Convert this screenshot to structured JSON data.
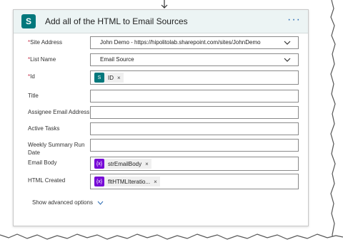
{
  "action": {
    "title": "Add all of the HTML to Email Sources",
    "more_label": "···",
    "logo_letter": "S"
  },
  "fields": [
    {
      "label": "Site Address",
      "required": true,
      "value": "John Demo - https://hipolitolab.sharepoint.com/sites/JohnDemo",
      "type": "dropdown"
    },
    {
      "label": "List Name",
      "required": true,
      "value": "Email Source",
      "type": "dropdown"
    },
    {
      "label": "Id",
      "required": true,
      "token": "ID",
      "type": "token-sp"
    },
    {
      "label": "Title",
      "required": false,
      "value": "",
      "type": "text"
    },
    {
      "label": "Assignee Email Address",
      "required": false,
      "value": "",
      "type": "text"
    },
    {
      "label": "Active Tasks",
      "required": false,
      "value": "",
      "type": "text"
    },
    {
      "label": "Weekly Summary Run Date",
      "required": false,
      "value": "",
      "type": "text"
    },
    {
      "label": "Email Body",
      "required": false,
      "token": "strEmailBody",
      "type": "token-var"
    },
    {
      "label": "HTML Created",
      "required": false,
      "token": "fltHTMLIteratio...",
      "type": "token-var"
    }
  ],
  "required_marker": "*",
  "token_remove": "×",
  "var_icon_text": "{x}",
  "show_advanced": "Show advanced options",
  "colors": {
    "header_bg": "#ecf4f4",
    "sharepoint": "#03787c",
    "variable": "#770bd6",
    "required": "#c4314b",
    "link": "#2b6bb3"
  }
}
